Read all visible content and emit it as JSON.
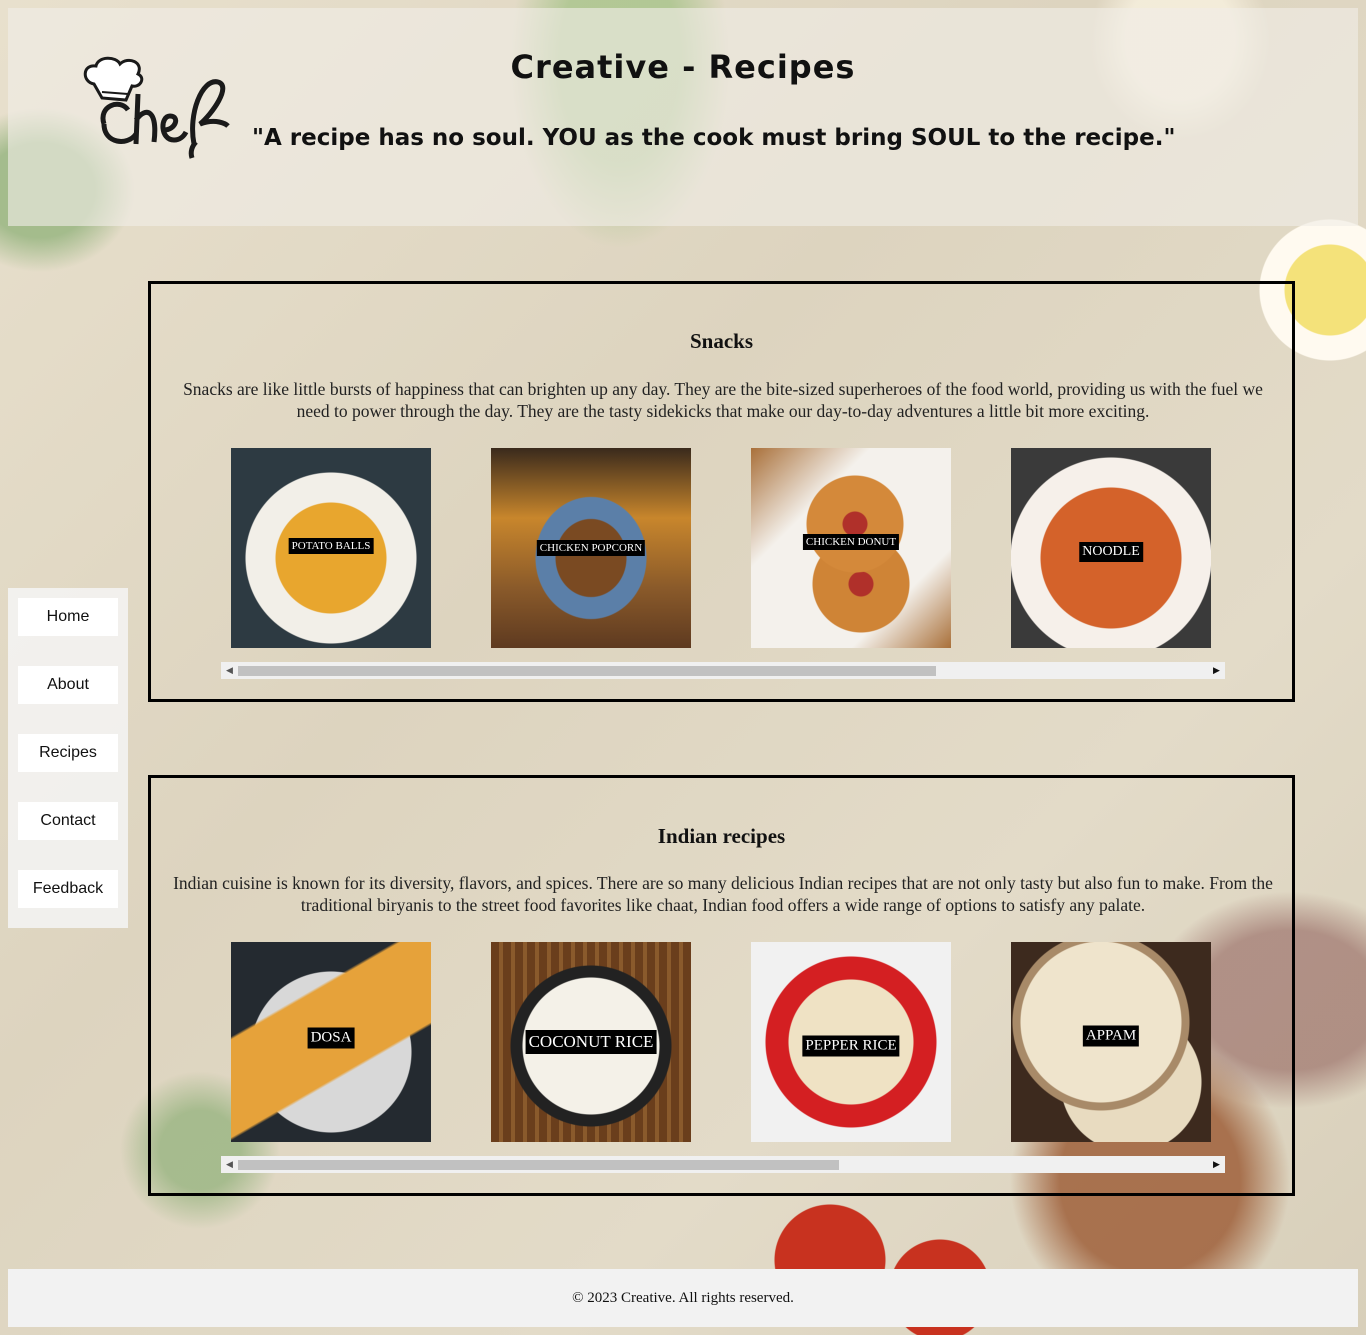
{
  "header": {
    "logo_text": "Chef",
    "title": "Creative - Recipes",
    "tagline": "\"A recipe has no soul. YOU as the cook must bring SOUL to the recipe.\""
  },
  "nav": {
    "items": [
      {
        "label": "Home"
      },
      {
        "label": "About"
      },
      {
        "label": "Recipes"
      },
      {
        "label": "Contact"
      },
      {
        "label": "Feedback"
      }
    ]
  },
  "sections": [
    {
      "title": "Snacks",
      "description": "Snacks are like little bursts of happiness that can brighten up any day. They are the bite-sized superheroes of the food world, providing us with the fuel we need to power through the day. They are the tasty sidekicks that make our day-to-day adventures a little bit more exciting.",
      "items": [
        {
          "label": "POTATO BALLS",
          "colors": [
            "#2d3a42",
            "#e0a630",
            "#c78320"
          ]
        },
        {
          "label": "CHICKEN POPCORN",
          "colors": [
            "#6b4a2a",
            "#c8862c",
            "#f0c060"
          ]
        },
        {
          "label": "CHICKEN DONUT",
          "colors": [
            "#a9703a",
            "#d0883a",
            "#f4f1ec"
          ]
        },
        {
          "label": "NOODLE",
          "colors": [
            "#3a3a3a",
            "#d4622a",
            "#f6f0ea"
          ]
        }
      ],
      "scroll_fraction": 0.72
    },
    {
      "title": "Indian recipes",
      "description": "Indian cuisine is known for its diversity, flavors, and spices. There are so many delicious Indian recipes that are not only tasty but also fun to make. From the traditional biryanis to the street food favorites like chaat, Indian food offers a wide range of options to satisfy any palate.",
      "items": [
        {
          "label": "DOSA",
          "colors": [
            "#242a30",
            "#e6a23a",
            "#d8d8d8"
          ]
        },
        {
          "label": "COCONUT RICE",
          "colors": [
            "#6a3e1c",
            "#f4f1e8",
            "#222222"
          ]
        },
        {
          "label": "PEPPER RICE",
          "colors": [
            "#1d1d1d",
            "#d41f22",
            "#f3e6c8"
          ]
        },
        {
          "label": "APPAM",
          "colors": [
            "#3d2a1e",
            "#efe4cc",
            "#9c8060"
          ]
        }
      ],
      "scroll_fraction": 0.62
    }
  ],
  "footer": {
    "text": "© 2023 Creative. All rights reserved."
  }
}
